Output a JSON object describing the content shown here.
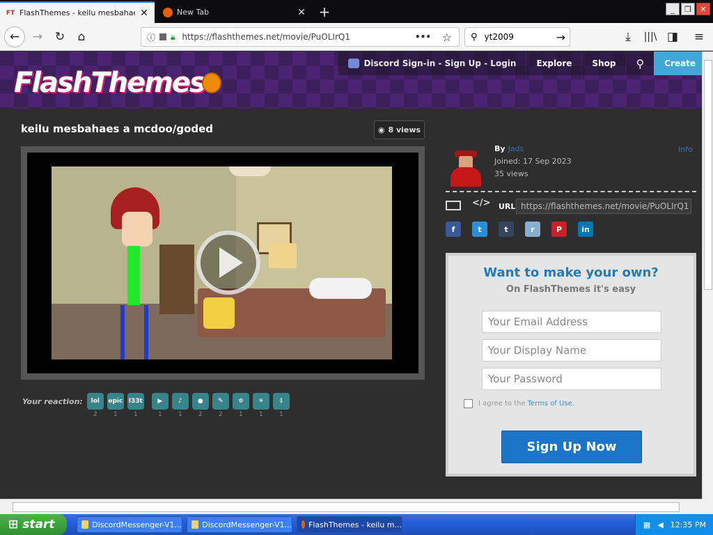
{
  "browser": {
    "tabs": [
      {
        "title": "FlashThemes - keilu mesbahaes a",
        "favicon": "FT",
        "active": true
      },
      {
        "title": "New Tab",
        "favicon": "firefox-icon",
        "active": false
      }
    ],
    "url": "https://flashthemes.net/movie/PuOLIrQ1",
    "search_value": "yt2009"
  },
  "site": {
    "logo": "FlashThemes",
    "nav": {
      "discord": "Discord Sign-in - Sign Up - Login",
      "explore": "Explore",
      "shop": "Shop",
      "create": "Create"
    }
  },
  "movie": {
    "title": "keilu mesbahaes a mcdoo/goded",
    "views": "8 views"
  },
  "reactions": {
    "label": "Your reaction:",
    "items": [
      {
        "name": "lol",
        "count": "2"
      },
      {
        "name": "epic",
        "count": "1"
      },
      {
        "name": "l33t",
        "count": "1"
      },
      {
        "name": "camera",
        "count": "1"
      },
      {
        "name": "sound",
        "count": "1"
      },
      {
        "name": "mic",
        "count": "2"
      },
      {
        "name": "brush",
        "count": "2"
      },
      {
        "name": "film",
        "count": "1"
      },
      {
        "name": "idea",
        "count": "1"
      },
      {
        "name": "upload",
        "count": "1"
      }
    ]
  },
  "author": {
    "by_label": "By",
    "name": "Jads",
    "joined": "Joined: 17 Sep 2023",
    "views": "35 views",
    "info": "Info"
  },
  "share": {
    "url_label": "URL",
    "url_value": "https://flashthemes.net/movie/PuOLIrQ1",
    "networks": [
      "f",
      "t",
      "t",
      "r",
      "P",
      "in"
    ]
  },
  "signup": {
    "heading": "Want to make your own?",
    "subheading": "On FlashThemes it's easy",
    "email_placeholder": "Your Email Address",
    "name_placeholder": "Your Display Name",
    "password_placeholder": "Your Password",
    "agree_text": "I agree to the",
    "tos_link": "Terms of Use.",
    "button": "Sign Up Now"
  },
  "taskbar": {
    "start": "start",
    "items": [
      {
        "title": "DiscordMessenger-V1...",
        "active": false
      },
      {
        "title": "DiscordMessenger-V1...",
        "active": false
      },
      {
        "title": "FlashThemes - keilu m...",
        "active": true
      }
    ],
    "clock": "12:35 PM"
  },
  "colors": {
    "accent": "#1a75c9",
    "header_purple": "#3d1f5c",
    "create_button": "#3fa8d8",
    "reaction_teal": "#37858a"
  }
}
